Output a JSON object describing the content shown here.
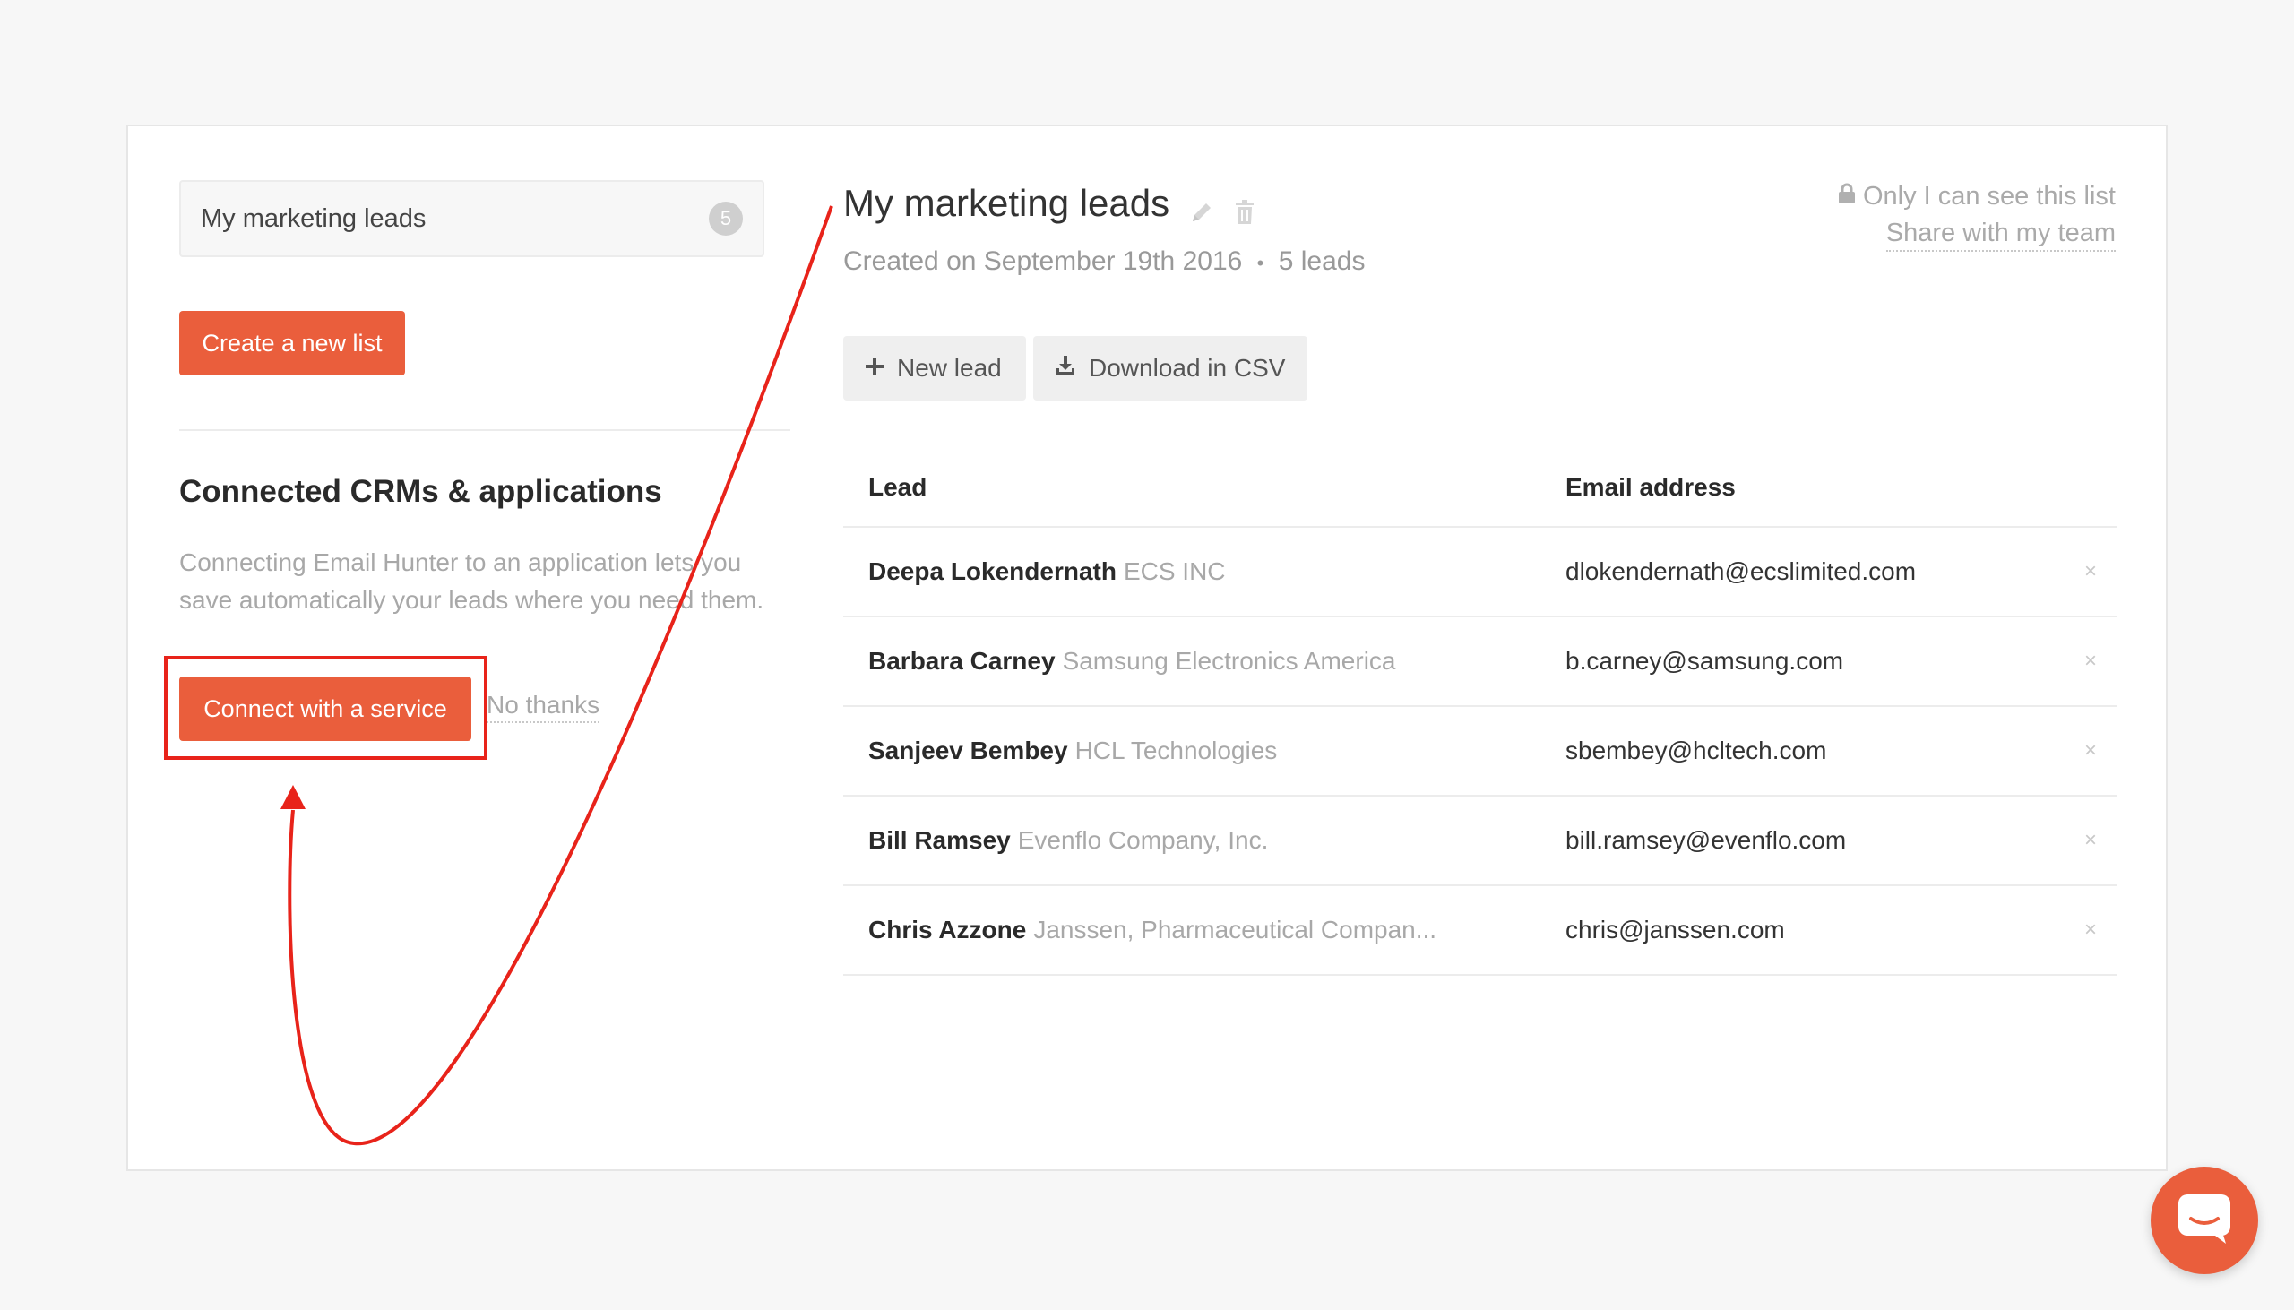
{
  "sidebar": {
    "list_name": "My marketing leads",
    "list_count": "5",
    "create_label": "Create a new list",
    "crm_title": "Connected CRMs & applications",
    "crm_description": "Connecting Email Hunter to an application lets you save automatically your leads where you need them.",
    "connect_label": "Connect with a service",
    "no_thanks_label": "No thanks"
  },
  "main": {
    "title": "My marketing leads",
    "created": "Created on September 19th 2016",
    "separator": "•",
    "leads_count": "5 leads",
    "privacy_label": "Only I can see this list",
    "share_label": "Share with my team",
    "new_lead_label": "New lead",
    "download_label": "Download in CSV",
    "table": {
      "headers": {
        "lead": "Lead",
        "email": "Email address"
      },
      "rows": [
        {
          "name": "Deepa Lokendernath",
          "company": "ECS INC",
          "email": "dlokendernath@ecslimited.com"
        },
        {
          "name": "Barbara Carney",
          "company": "Samsung Electronics America",
          "email": "b.carney@samsung.com"
        },
        {
          "name": "Sanjeev Bembey",
          "company": "HCL Technologies",
          "email": "sbembey@hcltech.com"
        },
        {
          "name": "Bill Ramsey",
          "company": "Evenflo Company, Inc.",
          "email": "bill.ramsey@evenflo.com"
        },
        {
          "name": "Chris Azzone",
          "company": "Janssen, Pharmaceutical Compan...",
          "email": "chris@janssen.com"
        }
      ],
      "delete_glyph": "×"
    }
  },
  "icons": {
    "edit": "pencil-icon",
    "delete": "trash-icon",
    "lock": "lock-icon",
    "plus": "plus-icon",
    "download": "download-icon",
    "chat": "chat-icon"
  },
  "colors": {
    "accent": "#ea5e3c",
    "annotation": "#e8231a"
  }
}
